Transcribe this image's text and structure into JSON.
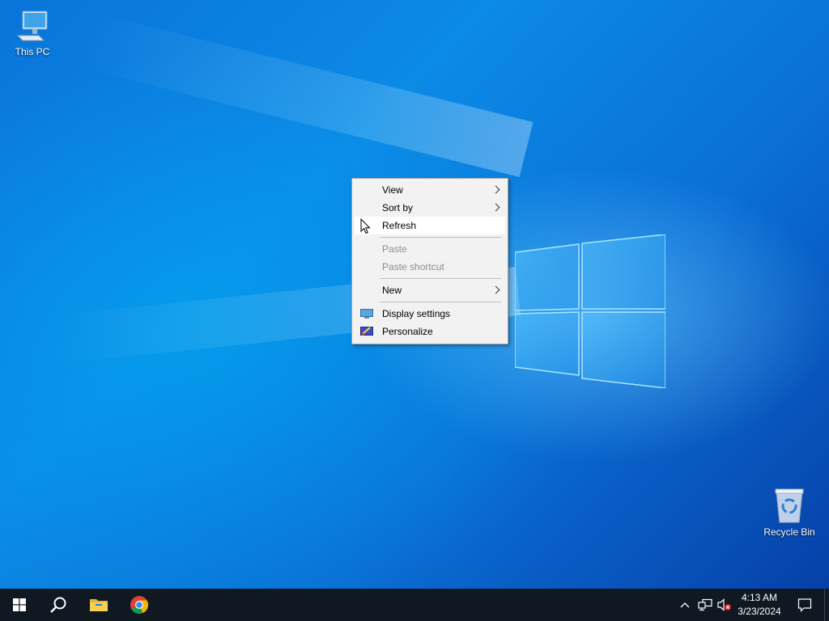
{
  "desktop": {
    "icons": [
      {
        "label": "This PC",
        "icon": "computer-icon"
      },
      {
        "label": "Recycle Bin",
        "icon": "recycle-bin-icon"
      }
    ]
  },
  "context_menu": {
    "items": [
      {
        "label": "View",
        "has_submenu": true,
        "enabled": true
      },
      {
        "label": "Sort by",
        "has_submenu": true,
        "enabled": true
      },
      {
        "label": "Refresh",
        "has_submenu": false,
        "enabled": true,
        "highlighted": true
      },
      {
        "label": "Paste",
        "has_submenu": false,
        "enabled": false
      },
      {
        "label": "Paste shortcut",
        "has_submenu": false,
        "enabled": false
      },
      {
        "label": "New",
        "has_submenu": true,
        "enabled": true
      },
      {
        "label": "Display settings",
        "has_submenu": false,
        "enabled": true,
        "icon": "display-settings-icon"
      },
      {
        "label": "Personalize",
        "has_submenu": false,
        "enabled": true,
        "icon": "personalize-icon"
      }
    ]
  },
  "taskbar": {
    "apps": [
      {
        "name": "start",
        "icon": "windows-start-icon"
      },
      {
        "name": "search",
        "icon": "search-icon"
      },
      {
        "name": "file-explorer",
        "icon": "folder-icon"
      },
      {
        "name": "chrome",
        "icon": "chrome-icon"
      }
    ],
    "tray": {
      "icons": [
        "chevron-up-icon",
        "network-icon",
        "volume-muted-icon"
      ],
      "time": "4:13 AM",
      "date": "3/23/2024"
    }
  },
  "colors": {
    "taskbar_bg": "#101822",
    "menu_bg": "#f2f2f2",
    "menu_highlight": "#ffffff",
    "disabled_text": "#8d8d8d",
    "desktop_accent": "#0a74d9"
  }
}
